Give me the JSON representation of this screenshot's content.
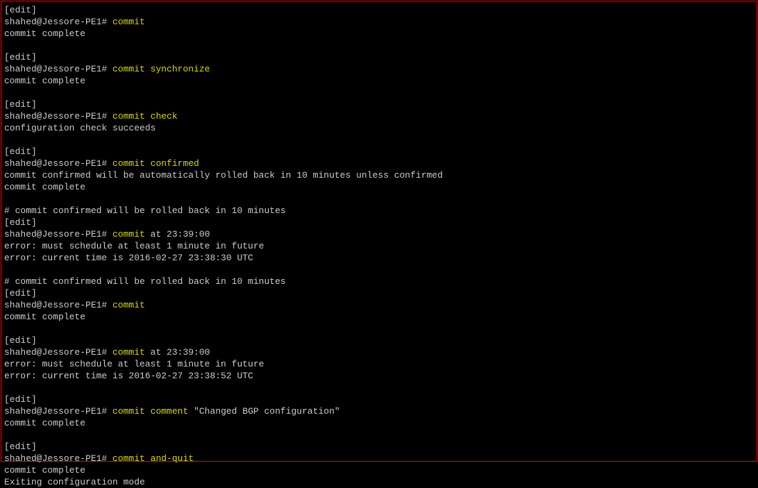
{
  "colors": {
    "border": "#ff0000",
    "bg": "#000000",
    "text": "#cccccc",
    "cmd": "#dada00"
  },
  "prompt": "shahed@Jessore-PE1# ",
  "g1": {
    "edit": "[edit]",
    "cmd": "commit",
    "out1": "commit complete"
  },
  "g2": {
    "edit": "[edit]",
    "cmd": "commit synchronize",
    "out1": "commit complete"
  },
  "g3": {
    "edit": "[edit]",
    "cmd": "commit check",
    "out1": "configuration check succeeds"
  },
  "g4": {
    "edit": "[edit]",
    "cmd": "commit confirmed",
    "out1": "commit confirmed will be automatically rolled back in 10 minutes unless confirmed",
    "out2": "commit complete"
  },
  "g5": {
    "note": "# commit confirmed will be rolled back in 10 minutes",
    "edit": "[edit]",
    "cmd_pre": "commit ",
    "cmd_post": "at 23:39:00",
    "out1": "error: must schedule at least 1 minute in future",
    "out2": "error: current time is 2016-02-27 23:38:30 UTC"
  },
  "g6": {
    "note": "# commit confirmed will be rolled back in 10 minutes",
    "edit": "[edit]",
    "cmd": "commit",
    "out1": "commit complete"
  },
  "g7": {
    "edit": "[edit]",
    "cmd_pre": "commit ",
    "cmd_post": "at 23:39:00",
    "out1": "error: must schedule at least 1 minute in future",
    "out2": "error: current time is 2016-02-27 23:38:52 UTC"
  },
  "g8": {
    "edit": "[edit]",
    "cmd_pre": "commit comment ",
    "cmd_post": "\"Changed BGP configuration\"",
    "out1": "commit complete"
  },
  "g9": {
    "edit": "[edit]",
    "cmd": "commit and-quit",
    "out1": "commit complete",
    "out2": "Exiting configuration mode"
  }
}
